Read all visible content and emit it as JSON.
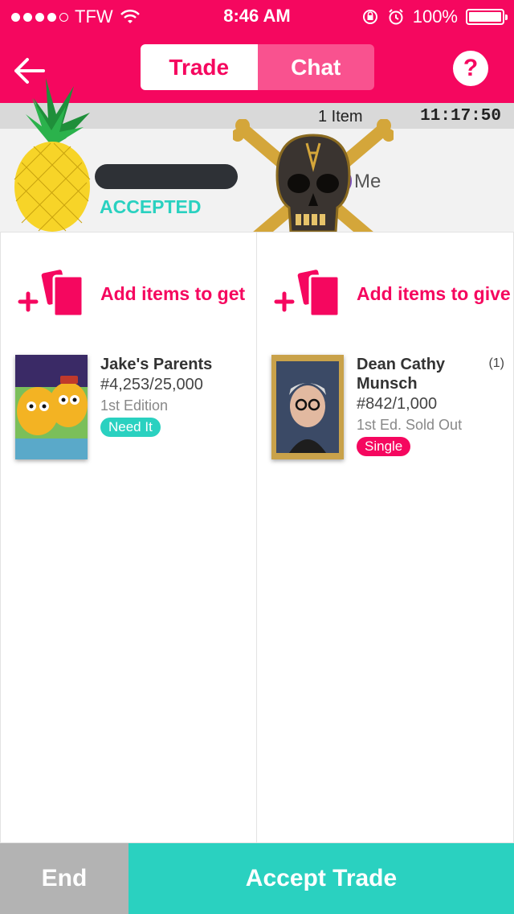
{
  "status_bar": {
    "carrier": "TFW",
    "time": "8:46 AM",
    "battery": "100%",
    "signal_bars_filled": 4,
    "signal_bars_total": 5
  },
  "header": {
    "tabs": [
      {
        "label": "Trade",
        "active": true
      },
      {
        "label": "Chat",
        "active": false
      }
    ],
    "help_label": "?",
    "brand_color": "#f5075f"
  },
  "info_bar": {
    "item_count": "1 Item",
    "timer": "11:17:50"
  },
  "parties": {
    "partner_status": "ACCEPTED",
    "me_label": "Me"
  },
  "columns": {
    "get": {
      "add_label": "Add items to get",
      "item": {
        "title": "Jake's Parents",
        "number": "#4,253/25,000",
        "edition": "1st Edition",
        "badge": "Need It",
        "badge_color": "#2ad1c0"
      }
    },
    "give": {
      "add_label": "Add items to give",
      "item": {
        "title": "Dean Cathy Munsch",
        "quantity": "(1)",
        "number": "#842/1,000",
        "edition": "1st Ed. Sold Out",
        "badge": "Single",
        "badge_color": "#f5075f"
      }
    }
  },
  "footer": {
    "end_label": "End",
    "accept_label": "Accept Trade",
    "accept_color": "#2ad1c0"
  }
}
